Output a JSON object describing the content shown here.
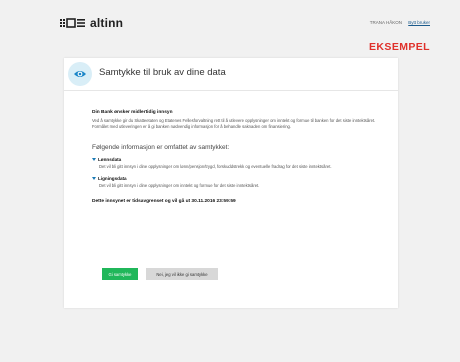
{
  "header": {
    "logo_text": "altinn",
    "user_name": "TRANA HÅKON",
    "switch_user_label": "Bytt bruker",
    "sample_stamp": "EKSEMPEL"
  },
  "card": {
    "title": "Samtykke til bruk av dine data",
    "intro_heading": "Din Bank ønsker midlertidig innsyn",
    "intro_text": "Ved å samtykke gir du Skatteetaten og Etatenes Fellesforvaltning rett til å utlevere opplysninger om inntekt og formue til banken for det siste inntektsåret. Formålet med utleveringen er å gi banken nødvendig informasjon for å behandle saknaden om finansiering.",
    "included_title": "Følgende informasjon er omfattet av samtykket:",
    "items": [
      {
        "label": "Lønnsdata",
        "text": "Det vil bli gitt innsyn i dine opplysninger om lønn/pensjon/trygd, forskuddstrekk og eventuelle fradrag for det siste inntektsåret."
      },
      {
        "label": "Ligningsdata",
        "text": "Det vil bli gitt innsyn i dine opplysninger om inntekt og formue for det siste inntektsåret."
      }
    ],
    "notice": "Dette innsynet er tidsavgrenset og vil gå ut 30.11.2016 23:59:59",
    "accept_label": "Gi samtykke",
    "decline_label": "Nei, jeg vil ikke gi samtykke"
  },
  "colors": {
    "accent_green": "#20b75a",
    "stamp_red": "#e0312b",
    "link_blue": "#1a5a8c",
    "toggle_blue": "#1a7ab5",
    "icon_bg": "#d9eef7"
  }
}
